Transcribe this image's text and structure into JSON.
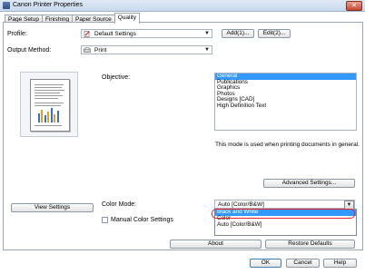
{
  "window": {
    "title": "Canon Printer Properties",
    "close_glyph": "✕"
  },
  "tabs": [
    {
      "label": "Page Setup"
    },
    {
      "label": "Finishing"
    },
    {
      "label": "Paper Source"
    },
    {
      "label": "Quality",
      "active": true
    }
  ],
  "profile": {
    "label": "Profile:",
    "value": "Default Settings",
    "add_label": "Add(1)...",
    "edit_label": "Edit(2)..."
  },
  "output_method": {
    "label": "Output Method:",
    "value": "Print"
  },
  "objective": {
    "label": "Objective:",
    "items": [
      "General",
      "Publications",
      "Graphics",
      "Photos",
      "Designs [CAD]",
      "High Definition Text"
    ],
    "selected_index": 0,
    "description": "This mode is used when printing documents in general."
  },
  "advanced_settings_label": "Advanced Settings...",
  "view_settings_label": "View Settings",
  "color_mode": {
    "label": "Color Mode:",
    "value": "Auto [Color/B&W]",
    "options": [
      "Black and White",
      "Color",
      "Auto [Color/B&W]"
    ],
    "highlighted_index": 0
  },
  "manual_color": {
    "label": "Manual Color Settings"
  },
  "about_label": "About",
  "restore_defaults_label": "Restore Defaults",
  "footer": {
    "ok_label": "OK",
    "cancel_label": "Cancel",
    "help_label": "Help"
  },
  "colors": {
    "selection": "#3399ff",
    "highlight_border": "#e2262b"
  },
  "icons": {
    "profile": "profile-icon",
    "output": "printer-icon",
    "combo": "chevron-down-icon"
  }
}
